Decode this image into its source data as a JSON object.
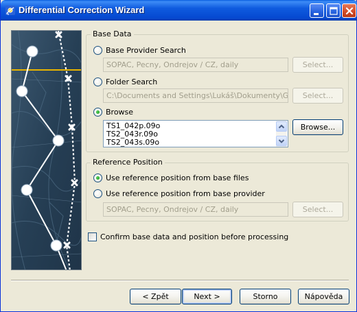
{
  "window": {
    "title": "Differential Correction Wizard"
  },
  "base_data": {
    "legend": "Base Data",
    "options": {
      "provider_search": {
        "label": "Base Provider Search",
        "selected": false,
        "field_value": "SOPAC, Pecny, Ondrejov / CZ, daily",
        "button_label": "Select..."
      },
      "folder_search": {
        "label": "Folder Search",
        "selected": false,
        "field_value": "C:\\Documents and Settings\\Lukáš\\Dokumenty\\GPS Pro",
        "button_label": "Select..."
      },
      "browse": {
        "label": "Browse",
        "selected": true,
        "files": [
          "TS1_042p.09o",
          "TS2_043r.09o",
          "TS2_043s.09o"
        ],
        "button_label": "Browse..."
      }
    }
  },
  "reference_position": {
    "legend": "Reference Position",
    "options": {
      "from_base_files": {
        "label": "Use reference position from base files",
        "selected": true
      },
      "from_base_provider": {
        "label": "Use reference position from base provider",
        "selected": false,
        "field_value": "SOPAC, Pecny, Ondrejov / CZ, daily",
        "button_label": "Select..."
      }
    }
  },
  "confirm": {
    "label": "Confirm base data and position before processing",
    "checked": false
  },
  "footer": {
    "back": "< Zpět",
    "next": "Next >",
    "cancel": "Storno",
    "help": "Nápověda"
  },
  "icons": {
    "app": "satellite-icon",
    "minimize": "minimize-icon",
    "maximize": "maximize-icon",
    "close": "close-icon"
  },
  "colors": {
    "titlebar": "#0548d0",
    "dialog_bg": "#ece9d8",
    "radio_selected": "#21a121",
    "side_image_accent": "#e8b400"
  }
}
